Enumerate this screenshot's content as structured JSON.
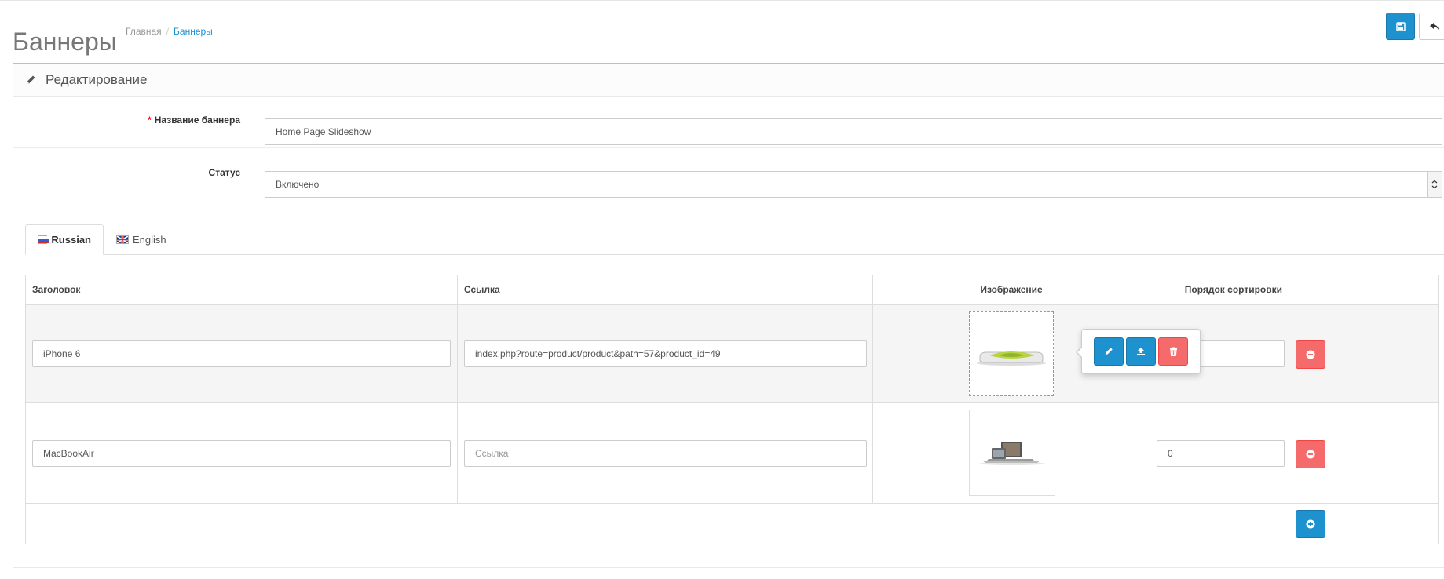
{
  "header": {
    "title": "Баннеры",
    "breadcrumb": [
      {
        "label": "Главная"
      },
      {
        "label": "Баннеры"
      }
    ]
  },
  "panel": {
    "title": "Редактирование"
  },
  "form": {
    "name_label": "Название баннера",
    "name_value": "Home Page Slideshow",
    "status_label": "Статус",
    "status_value": "Включено"
  },
  "tabs": [
    {
      "label": "Russian",
      "active": true
    },
    {
      "label": "English",
      "active": false
    }
  ],
  "table": {
    "headers": [
      "Заголовок",
      "Ссылка",
      "Изображение",
      "Порядок сортировки"
    ],
    "rows": [
      {
        "title": "iPhone 6",
        "link": "index.php?route=product/product&path=57&product_id=49",
        "link_placeholder": "Ссылка",
        "sort_order": ""
      },
      {
        "title": "MacBookAir",
        "link": "",
        "link_placeholder": "Ссылка",
        "sort_order": "0"
      }
    ]
  },
  "colors": {
    "primary": "#1e91cf",
    "danger": "#f56b6b"
  }
}
